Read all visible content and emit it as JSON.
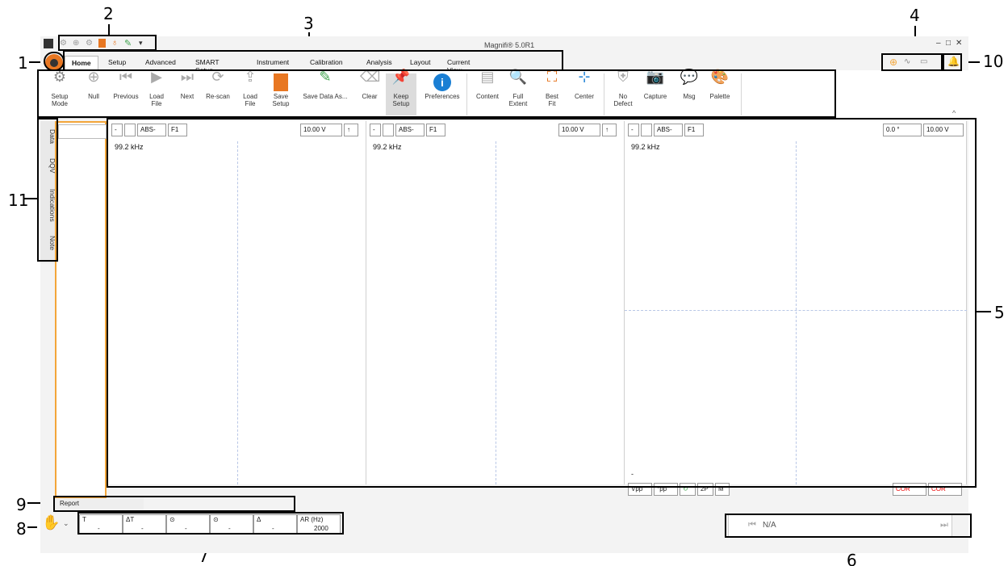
{
  "callouts": [
    "1",
    "2",
    "3",
    "4",
    "5",
    "6",
    "7",
    "8",
    "9",
    "10",
    "11"
  ],
  "app": {
    "title": "Magnifi® 5.0R1",
    "window_controls": [
      "–",
      "□",
      "✕"
    ]
  },
  "ribbon": {
    "tabs": [
      "Home",
      "Setup",
      "Advanced",
      "SMART Setup",
      "Instrument",
      "Calibration",
      "Analysis",
      "Layout",
      "Current View"
    ],
    "active_tab": "Home",
    "buttons": [
      {
        "label": "Setup\nMode",
        "icon": "gear-icon",
        "enabled": true
      },
      {
        "label": "Null",
        "icon": "crosshair-icon",
        "enabled": false
      },
      {
        "label": "Previous",
        "icon": "previous-icon",
        "enabled": false
      },
      {
        "label": "Load\nFile",
        "icon": "play-icon",
        "enabled": false
      },
      {
        "label": "Next",
        "icon": "next-icon",
        "enabled": false
      },
      {
        "label": "Re-scan",
        "icon": "rescan-icon",
        "enabled": false
      },
      {
        "label": "Load\nFile",
        "icon": "upload-icon",
        "enabled": false
      },
      {
        "label": "Save\nSetup",
        "icon": "save-setup-icon",
        "enabled": true
      },
      {
        "label": "Save Data As...",
        "icon": "pen-icon",
        "enabled": true
      },
      {
        "label": "Clear",
        "icon": "eraser-icon",
        "enabled": false
      },
      {
        "label": "Keep\nSetup",
        "icon": "pin-icon",
        "enabled": true
      },
      {
        "label": "Preferences",
        "icon": "info-icon",
        "enabled": true
      },
      {
        "label": "Content",
        "icon": "content-icon",
        "enabled": false
      },
      {
        "label": "Full\nExtent",
        "icon": "zoom-icon",
        "enabled": true
      },
      {
        "label": "Best\nFit",
        "icon": "best-fit-icon",
        "enabled": true
      },
      {
        "label": "Center",
        "icon": "center-icon",
        "enabled": true
      },
      {
        "label": "No\nDefect",
        "icon": "shield-icon",
        "enabled": false
      },
      {
        "label": "Capture",
        "icon": "camera-icon",
        "enabled": false
      },
      {
        "label": "Msg",
        "icon": "message-icon",
        "enabled": false
      },
      {
        "label": "Palette",
        "icon": "palette-icon",
        "enabled": false
      }
    ]
  },
  "side_tabs": [
    "Data",
    "DQV",
    "Indications",
    "Note"
  ],
  "panels": [
    {
      "tool1": "-",
      "tool2": "",
      "mode": "ABS-",
      "freq_sel": "F1",
      "volt": "10.00 V",
      "freq": "99.2 kHz"
    },
    {
      "tool1": "-",
      "tool2": "",
      "mode": "ABS-",
      "freq_sel": "F1",
      "volt": "10.00 V",
      "freq": "99.2 kHz"
    },
    {
      "tool1": "-",
      "tool2": "",
      "mode": "ABS-",
      "freq_sel": "F1",
      "angle": "0.0 °",
      "volt": "10.00 V",
      "freq": "99.2 kHz",
      "corner": "-"
    }
  ],
  "panel3_bottom": [
    "Vpp",
    "°pp",
    "↻",
    "2P",
    "M",
    "COR",
    "COR"
  ],
  "report_tab": "Report",
  "status": {
    "cells": [
      {
        "label": "T",
        "value": "-"
      },
      {
        "label": "ΔT",
        "value": "-"
      },
      {
        "label": "⊙",
        "value": "-"
      },
      {
        "label": "⊙",
        "value": "-"
      },
      {
        "label": "Δ",
        "value": "-"
      },
      {
        "label": "AR (Hz)",
        "value": "2000"
      }
    ],
    "na_text": "N/A"
  },
  "colors": {
    "accent": "#f3a63a",
    "save": "#e87722",
    "pin": "#3fa34d",
    "info": "#1a7fd4"
  }
}
